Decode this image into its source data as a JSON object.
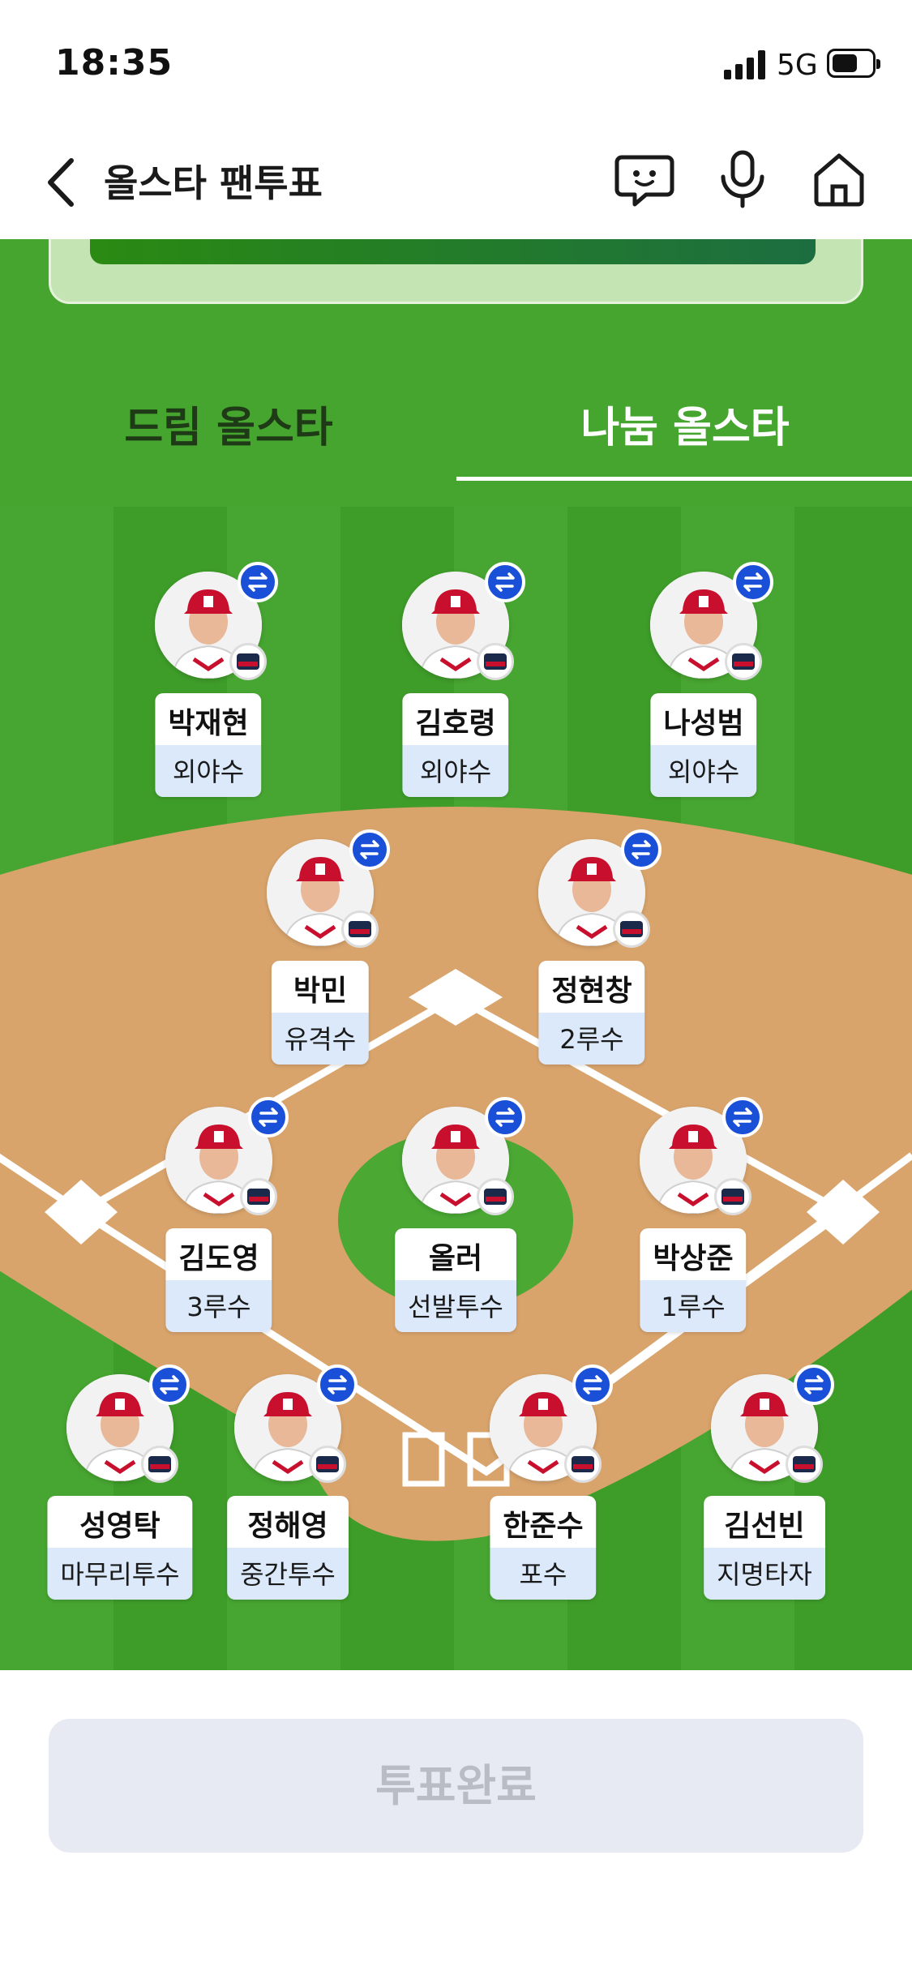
{
  "status_bar": {
    "time": "18:35",
    "network": "5G"
  },
  "nav": {
    "title": "올스타 팬투표",
    "icons": [
      "back-icon",
      "chat-icon",
      "mic-icon",
      "home-icon"
    ]
  },
  "tabs": [
    {
      "label": "드림 올스타",
      "selected": false
    },
    {
      "label": "나눔 올스타",
      "selected": true
    }
  ],
  "players": [
    {
      "name": "박재현",
      "position": "외야수"
    },
    {
      "name": "김호령",
      "position": "외야수"
    },
    {
      "name": "나성범",
      "position": "외야수"
    },
    {
      "name": "박민",
      "position": "유격수"
    },
    {
      "name": "정현창",
      "position": "2루수"
    },
    {
      "name": "김도영",
      "position": "3루수"
    },
    {
      "name": "올러",
      "position": "선발투수"
    },
    {
      "name": "박상준",
      "position": "1루수"
    },
    {
      "name": "성영탁",
      "position": "마무리투수"
    },
    {
      "name": "정해영",
      "position": "중간투수"
    },
    {
      "name": "한준수",
      "position": "포수"
    },
    {
      "name": "김선빈",
      "position": "지명타자"
    }
  ],
  "vote_button": {
    "label": "투표완료",
    "enabled": false
  },
  "colors": {
    "grass": "#3f9e2a",
    "dirt": "#d9a46c",
    "swap_badge": "#1a4fd8",
    "position_bg": "#dbe9fb"
  }
}
